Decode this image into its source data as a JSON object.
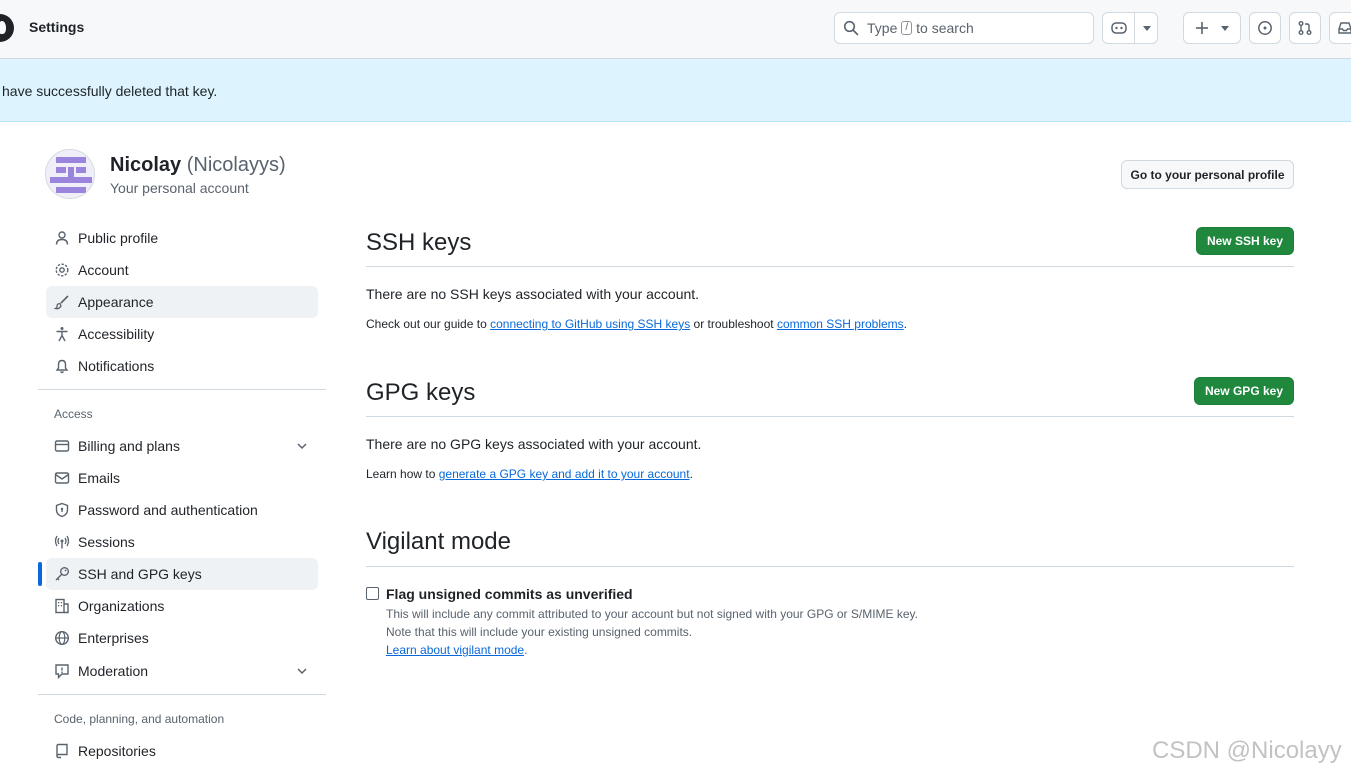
{
  "header": {
    "title": "Settings",
    "search_prefix": "Type",
    "search_key": "/",
    "search_suffix": "to search"
  },
  "flash": {
    "message": "have successfully deleted that key."
  },
  "account": {
    "name": "Nicolay",
    "login": "(Nicolayys)",
    "subtitle": "Your personal account",
    "profile_button": "Go to your personal profile"
  },
  "sidebar": {
    "items_top": [
      {
        "label": "Public profile",
        "icon": "person-icon"
      },
      {
        "label": "Account",
        "icon": "gear-icon"
      },
      {
        "label": "Appearance",
        "icon": "paintbrush-icon"
      },
      {
        "label": "Accessibility",
        "icon": "accessibility-icon"
      },
      {
        "label": "Notifications",
        "icon": "bell-icon"
      }
    ],
    "access_heading": "Access",
    "items_access": [
      {
        "label": "Billing and plans",
        "icon": "credit-card-icon"
      },
      {
        "label": "Emails",
        "icon": "mail-icon"
      },
      {
        "label": "Password and authentication",
        "icon": "shield-lock-icon"
      },
      {
        "label": "Sessions",
        "icon": "broadcast-icon"
      },
      {
        "label": "SSH and GPG keys",
        "icon": "key-icon"
      },
      {
        "label": "Organizations",
        "icon": "organization-icon"
      },
      {
        "label": "Enterprises",
        "icon": "globe-icon"
      },
      {
        "label": "Moderation",
        "icon": "report-icon"
      }
    ],
    "code_heading": "Code, planning, and automation",
    "items_code": [
      {
        "label": "Repositories",
        "icon": "repo-icon"
      }
    ]
  },
  "ssh": {
    "title": "SSH keys",
    "button": "New SSH key",
    "empty": "There are no SSH keys associated with your account.",
    "guide_prefix": "Check out our guide to",
    "guide_link": "connecting to GitHub using SSH keys",
    "guide_middle": "or troubleshoot",
    "guide_link2": "common SSH problems",
    "guide_end": "."
  },
  "gpg": {
    "title": "GPG keys",
    "button": "New GPG key",
    "empty": "There are no GPG keys associated with your account.",
    "learn_prefix": "Learn how to",
    "learn_link": "generate a GPG key and add it to your account",
    "learn_end": "."
  },
  "vigilant": {
    "title": "Vigilant mode",
    "checkbox_label": "Flag unsigned commits as unverified",
    "checked": false,
    "note1": "This will include any commit attributed to your account but not signed with your GPG or S/MIME key.",
    "note2": "Note that this will include your existing unsigned commits.",
    "learn_link": "Learn about vigilant mode",
    "learn_end": "."
  },
  "watermark": "CSDN @Nicolayy",
  "colors": {
    "primary_button": "#1f883d",
    "link": "#0969da",
    "flash_bg": "#ddf4ff",
    "active_indicator": "#0969da"
  }
}
